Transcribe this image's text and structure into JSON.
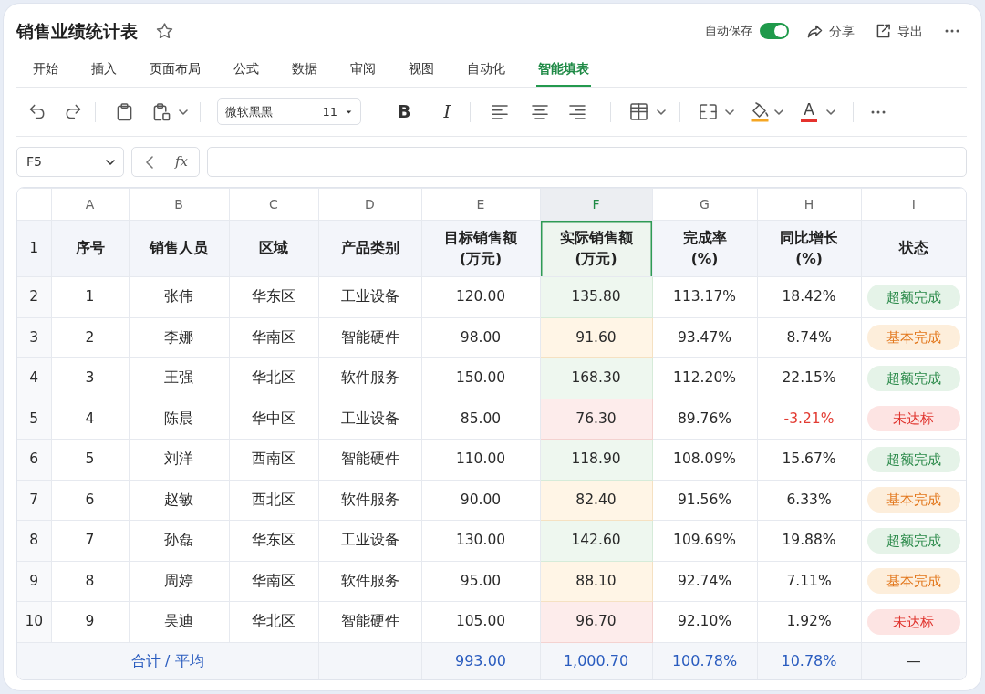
{
  "document": {
    "title": "销售业绩统计表",
    "starred": false
  },
  "header": {
    "autosave": {
      "label": "自动保存",
      "on": true
    },
    "actions": [
      {
        "kind": "share",
        "label": "分享"
      },
      {
        "kind": "export",
        "label": "导出"
      }
    ]
  },
  "ribbon_tabs": [
    {
      "label": "开始",
      "selected": false
    },
    {
      "label": "插入",
      "selected": false
    },
    {
      "label": "页面布局",
      "selected": false
    },
    {
      "label": "公式",
      "selected": false
    },
    {
      "label": "数据",
      "selected": false
    },
    {
      "label": "审阅",
      "selected": false
    },
    {
      "label": "视图",
      "selected": false
    },
    {
      "label": "自动化",
      "selected": false
    },
    {
      "label": "智能填表",
      "selected": true
    }
  ],
  "toolbar": {
    "font_name": "微软黑黑",
    "font_size": "11",
    "bold_label": "B",
    "italic_label": "I",
    "font_color_label": "A"
  },
  "formula_bar": {
    "cell_reference": "F5",
    "function_label": "fx"
  },
  "sheet": {
    "columns": [
      {
        "letter": "A",
        "selected": false
      },
      {
        "letter": "B",
        "selected": false
      },
      {
        "letter": "C",
        "selected": false
      },
      {
        "letter": "D",
        "selected": false
      },
      {
        "letter": "E",
        "selected": false
      },
      {
        "letter": "F",
        "selected": true
      },
      {
        "letter": "G",
        "selected": false
      },
      {
        "letter": "H",
        "selected": false
      },
      {
        "letter": "I",
        "selected": false
      }
    ],
    "header_row": {
      "number": "1",
      "cells": [
        "序号",
        "销售人员",
        "区域",
        "产品类别",
        "目标销售额\n(万元)",
        "实际销售额\n(万元)",
        "完成率\n(%)",
        "同比增长\n(%)",
        "状态"
      ]
    },
    "rows": [
      {
        "number": "2",
        "cells": [
          "1",
          "张伟",
          "华东区",
          "工业设备",
          "120.00",
          "135.80",
          "113.17%",
          "18.42%"
        ],
        "growth_negative": false,
        "status": {
          "label": "超额完成",
          "kind": "exceeded"
        }
      },
      {
        "number": "3",
        "cells": [
          "2",
          "李娜",
          "华南区",
          "智能硬件",
          "98.00",
          "91.60",
          "93.47%",
          "8.74%"
        ],
        "growth_negative": false,
        "status": {
          "label": "基本完成",
          "kind": "basic"
        }
      },
      {
        "number": "4",
        "cells": [
          "3",
          "王强",
          "华北区",
          "软件服务",
          "150.00",
          "168.30",
          "112.20%",
          "22.15%"
        ],
        "growth_negative": false,
        "status": {
          "label": "超额完成",
          "kind": "exceeded"
        }
      },
      {
        "number": "5",
        "cells": [
          "4",
          "陈晨",
          "华中区",
          "工业设备",
          "85.00",
          "76.30",
          "89.76%",
          "-3.21%"
        ],
        "growth_negative": true,
        "status": {
          "label": "未达标",
          "kind": "missed"
        }
      },
      {
        "number": "6",
        "cells": [
          "5",
          "刘洋",
          "西南区",
          "智能硬件",
          "110.00",
          "118.90",
          "108.09%",
          "15.67%"
        ],
        "growth_negative": false,
        "status": {
          "label": "超额完成",
          "kind": "exceeded"
        }
      },
      {
        "number": "7",
        "cells": [
          "6",
          "赵敏",
          "西北区",
          "软件服务",
          "90.00",
          "82.40",
          "91.56%",
          "6.33%"
        ],
        "growth_negative": false,
        "status": {
          "label": "基本完成",
          "kind": "basic"
        }
      },
      {
        "number": "8",
        "cells": [
          "7",
          "孙磊",
          "华东区",
          "工业设备",
          "130.00",
          "142.60",
          "109.69%",
          "19.88%"
        ],
        "growth_negative": false,
        "status": {
          "label": "超额完成",
          "kind": "exceeded"
        }
      },
      {
        "number": "9",
        "cells": [
          "8",
          "周婷",
          "华南区",
          "软件服务",
          "95.00",
          "88.10",
          "92.74%",
          "7.11%"
        ],
        "growth_negative": false,
        "status": {
          "label": "基本完成",
          "kind": "basic"
        }
      },
      {
        "number": "10",
        "cells": [
          "9",
          "吴迪",
          "华北区",
          "智能硬件",
          "105.00",
          "96.70",
          "92.10%",
          "1.92%"
        ],
        "growth_negative": false,
        "status": {
          "label": "未达标",
          "kind": "missed"
        }
      }
    ],
    "total_row": {
      "label": "合计 / 平均",
      "values": [
        "993.00",
        "1,000.70",
        "100.78%",
        "10.78%"
      ],
      "status": "—"
    }
  }
}
